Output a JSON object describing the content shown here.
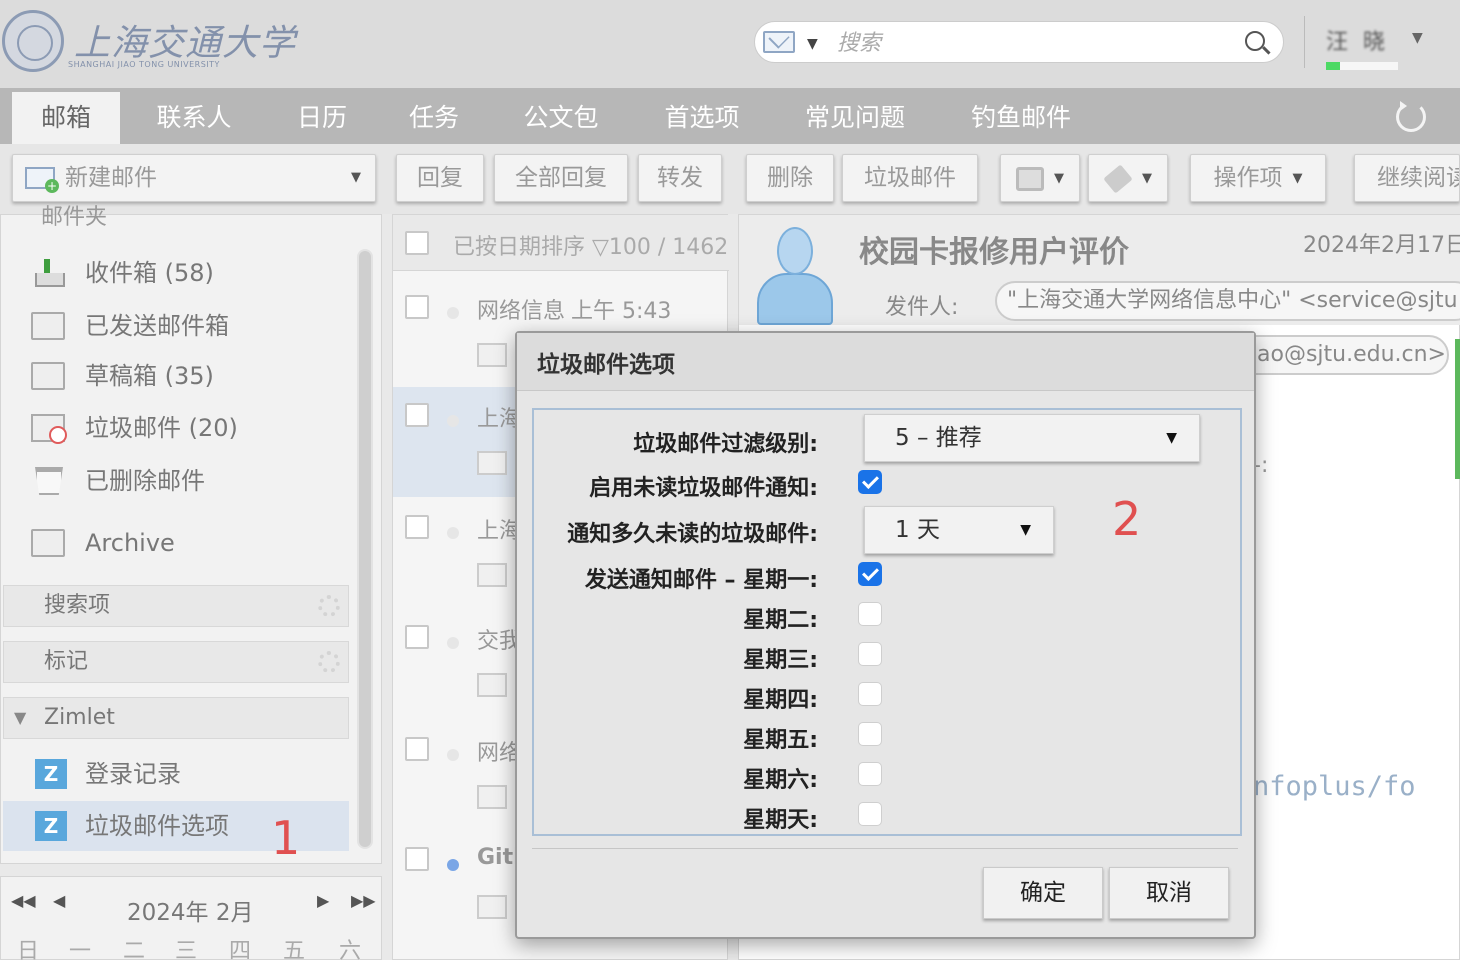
{
  "header": {
    "logo_cn": "上海交通大学",
    "logo_en": "SHANGHAI JIAO TONG UNIVERSITY",
    "search_placeholder": "搜索",
    "user_name": "汪 晓"
  },
  "tabs": [
    "邮箱",
    "联系人",
    "日历",
    "任务",
    "公文包",
    "首选项",
    "常见问题",
    "钓鱼邮件"
  ],
  "toolbar": {
    "new_mail": "新建邮件",
    "reply": "回复",
    "reply_all": "全部回复",
    "forward": "转发",
    "delete": "删除",
    "junk": "垃圾邮件",
    "actions": "操作项",
    "continue_read": "继续阅读"
  },
  "folders": {
    "section_clip": "邮件夹",
    "items": [
      {
        "label": "收件箱 (58)",
        "icon": "inbox-icon"
      },
      {
        "label": "已发送邮件箱",
        "icon": "sent-folder-icon"
      },
      {
        "label": "草稿箱 (35)",
        "icon": "drafts-folder-icon"
      },
      {
        "label": "垃圾邮件 (20)",
        "icon": "junk-folder-icon"
      },
      {
        "label": "已删除邮件",
        "icon": "trash-icon"
      },
      {
        "label": "Archive",
        "icon": "archive-folder-icon"
      }
    ],
    "sections": [
      "搜索项",
      "标记",
      "Zimlet"
    ],
    "zimlets": [
      "登录记录",
      "垃圾邮件选项"
    ]
  },
  "annotations": {
    "one": "1",
    "two": "2"
  },
  "calendar": {
    "month": "2024年 2月",
    "weekdays": [
      "日",
      "一",
      "二",
      "三",
      "四",
      "五",
      "六"
    ]
  },
  "list": {
    "sort_label": "已按日期排序 ▽100 / 1462",
    "rows": [
      {
        "sender": "网络信息",
        "time": "上午 5:43"
      },
      {
        "sender": "上海",
        "time": ""
      },
      {
        "sender": "上海",
        "time": ""
      },
      {
        "sender": "交我",
        "time": ""
      },
      {
        "sender": "网络",
        "time": ""
      },
      {
        "sender": "Gitl",
        "time": ""
      }
    ]
  },
  "reader": {
    "subject": "校园卡报修用户评价",
    "date": "2024年2月17日",
    "from_label": "发件人:",
    "from": "\"上海交通大学网络信息中心\" <service@sjtu",
    "to": "ao@sjtu.edu.cn>",
    "colon": "-:",
    "link": "nfoplus/fo"
  },
  "dialog": {
    "title": "垃圾邮件选项",
    "filter_label": "垃圾邮件过滤级别:",
    "filter_value": "5 – 推荐",
    "notify_label": "启用未读垃圾邮件通知:",
    "notify_checked": true,
    "howlong_label": "通知多久未读的垃圾邮件:",
    "howlong_value": "1 天",
    "days": [
      {
        "label": "发送通知邮件 – 星期一:",
        "checked": true
      },
      {
        "label": "星期二:",
        "checked": false
      },
      {
        "label": "星期三:",
        "checked": false
      },
      {
        "label": "星期四:",
        "checked": false
      },
      {
        "label": "星期五:",
        "checked": false
      },
      {
        "label": "星期六:",
        "checked": false
      },
      {
        "label": "星期天:",
        "checked": false
      }
    ],
    "ok": "确定",
    "cancel": "取消"
  }
}
